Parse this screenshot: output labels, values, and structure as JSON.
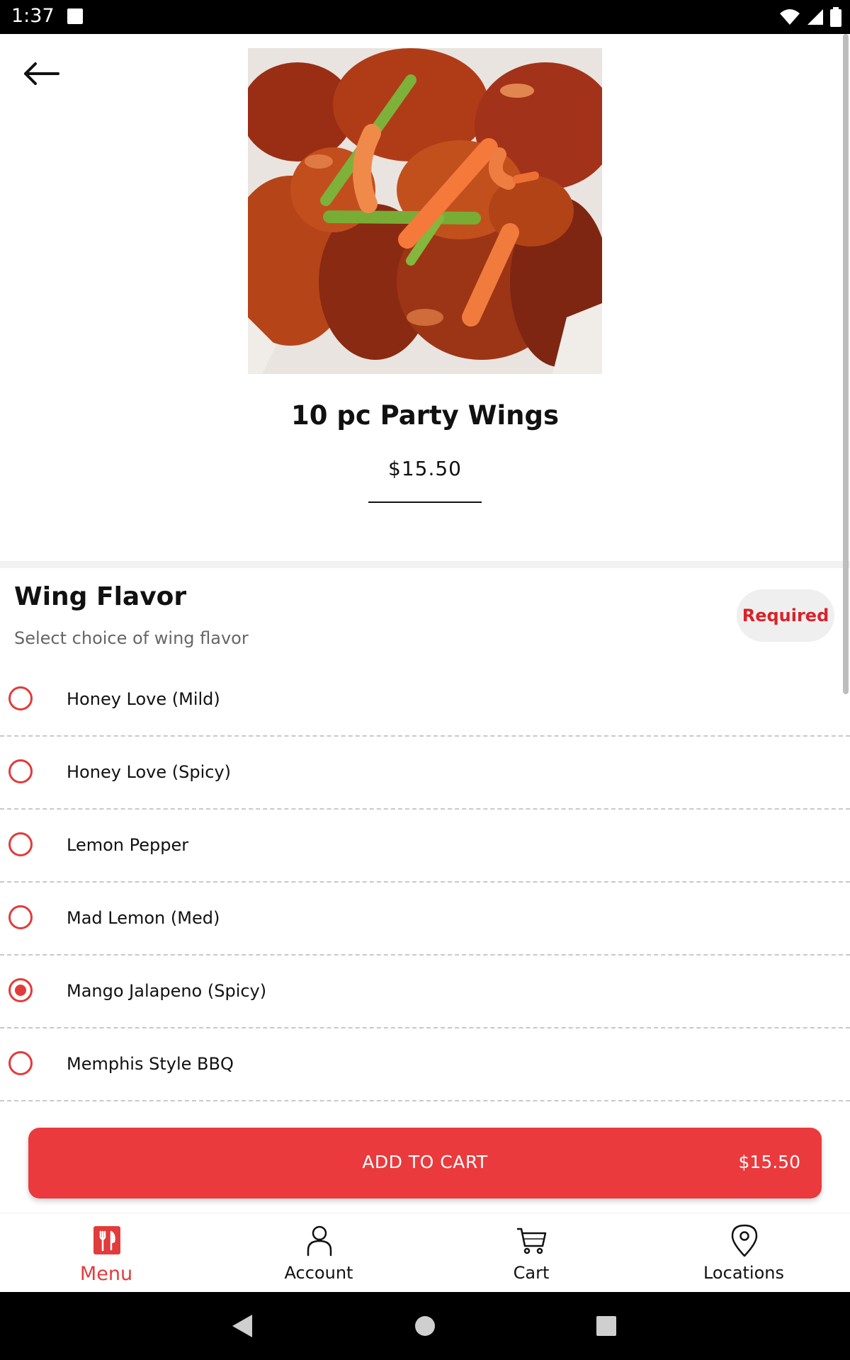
{
  "status_bar": {
    "time": "1:37"
  },
  "product": {
    "name": "10 pc Party Wings",
    "price": "$15.50"
  },
  "section": {
    "title": "Wing Flavor",
    "subtitle": "Select choice of wing flavor",
    "badge": "Required"
  },
  "options": [
    {
      "label": "Honey Love (Mild)",
      "selected": false
    },
    {
      "label": "Honey Love (Spicy)",
      "selected": false
    },
    {
      "label": "Lemon Pepper",
      "selected": false
    },
    {
      "label": "Mad Lemon (Med)",
      "selected": false
    },
    {
      "label": "Mango Jalapeno (Spicy)",
      "selected": true
    },
    {
      "label": "Memphis Style BBQ",
      "selected": false
    }
  ],
  "cart_button": {
    "label": "ADD TO CART",
    "price": "$15.50"
  },
  "bottom_nav": {
    "items": [
      {
        "label": "Menu",
        "icon": "fork-knife-icon",
        "active": true
      },
      {
        "label": "Account",
        "icon": "person-icon",
        "active": false
      },
      {
        "label": "Cart",
        "icon": "cart-icon",
        "active": false
      },
      {
        "label": "Locations",
        "icon": "location-pin-icon",
        "active": false
      }
    ]
  },
  "colors": {
    "accent": "#ea3a3d",
    "nav_active": "#e23b3b"
  }
}
